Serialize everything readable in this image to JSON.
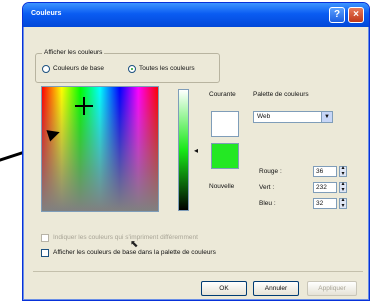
{
  "window": {
    "title": "Couleurs",
    "help": "?",
    "close": "×"
  },
  "display_group": {
    "legend": "Afficher les couleurs",
    "options": [
      {
        "label": "Couleurs de base",
        "checked": false
      },
      {
        "label": "Toutes les couleurs",
        "checked": true
      }
    ]
  },
  "swatches": {
    "current_label": "Courante",
    "new_label": "Nouvelle",
    "current_color": "#ffffff",
    "new_color": "#24e824"
  },
  "palette": {
    "label": "Palette de couleurs",
    "value": "Web"
  },
  "rgb": {
    "red_label": "Rouge :",
    "red": "36",
    "green_label": "Vert :",
    "green": "232",
    "blue_label": "Bleu :",
    "blue": "32"
  },
  "checkboxes": {
    "dither": "Indiquer les couleurs qui s'impriment différemment",
    "show_base": "Afficher les couleurs de base dans la palette de couleurs"
  },
  "buttons": {
    "ok": "OK",
    "cancel": "Annuler",
    "apply": "Appliquer"
  }
}
